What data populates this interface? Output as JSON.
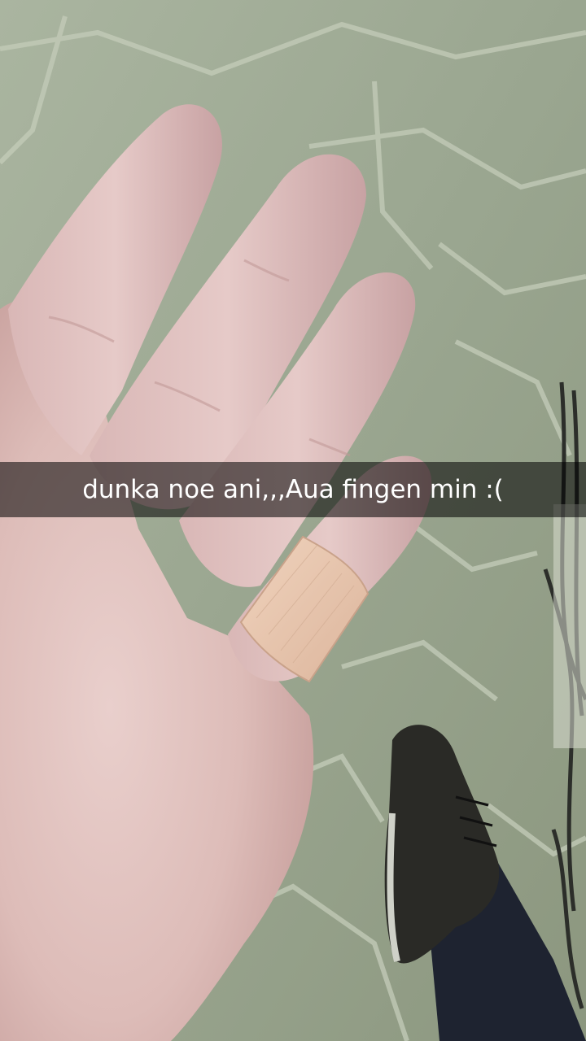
{
  "snap": {
    "caption": "dunka noe ani,,,Aua fingen min :("
  },
  "colors": {
    "caption_bar": "#000000",
    "caption_text": "#ffffff",
    "skin": "#e4c5c3",
    "bandage": "#e9c7ad",
    "floor": "#9fab95",
    "shoe": "#2a2a26",
    "jeans": "#1e2330"
  }
}
